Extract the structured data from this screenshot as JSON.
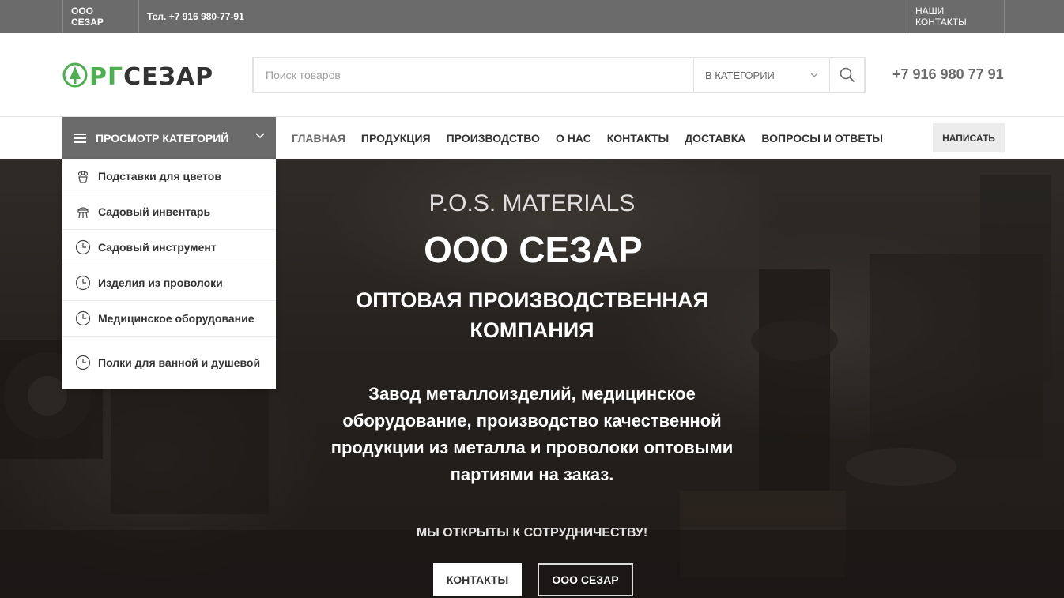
{
  "topbar": {
    "company": "ООО СЕЗАР",
    "phone": "Тел. +7 916 980-77-91",
    "contacts": "НАШИ КОНТАКТЫ"
  },
  "header": {
    "logo_text": "ОРГСЕЗАР",
    "search_placeholder": "Поиск товаров",
    "category_select": "В КАТЕГОРИИ",
    "phone": "+7 916 980 77 91"
  },
  "nav": {
    "categories_button": "ПРОСМОТР КАТЕГОРИЙ",
    "items": [
      {
        "label": "ГЛАВНАЯ"
      },
      {
        "label": "ПРОДУКЦИЯ"
      },
      {
        "label": "ПРОИЗВОДСТВО"
      },
      {
        "label": "О НАС"
      },
      {
        "label": "КОНТАКТЫ"
      },
      {
        "label": "ДОСТАВКА"
      },
      {
        "label": "ВОПРОСЫ И ОТВЕТЫ"
      }
    ],
    "write_button": "НАПИСАТЬ"
  },
  "categories": [
    {
      "label": "Подставки для цветов",
      "icon": "flower-pot-icon"
    },
    {
      "label": "Садовый инвентарь",
      "icon": "garden-tools-icon"
    },
    {
      "label": "Садовый инструмент",
      "icon": "clock-icon"
    },
    {
      "label": "Изделия из проволоки",
      "icon": "clock-icon"
    },
    {
      "label": "Медицинское оборудование",
      "icon": "clock-icon"
    },
    {
      "label": "Полки для ванной и душевой",
      "icon": "clock-icon"
    }
  ],
  "hero": {
    "subtitle": "P.O.S. MATERIALS",
    "title": "ООО СЕЗАР",
    "tagline_line1": "ОПТОВАЯ ПРОИЗВОДСТВЕННАЯ",
    "tagline_line2": "КОМПАНИЯ",
    "desc_line1": "Завод металлоизделий, медицинское",
    "desc_line2": "оборудование, производство качественной",
    "desc_line3": "продукции из металла и проволоки оптовыми",
    "desc_line4": "партиями на заказ.",
    "cooperation": "МЫ ОТКРЫТЫ К СОТРУДНИЧЕСТВУ!",
    "button_contacts": "КОНТАКТЫ",
    "button_company": "ООО СЕЗАР"
  },
  "colors": {
    "accent_green": "#4caf50",
    "gray_bar": "#6b6b6b"
  }
}
